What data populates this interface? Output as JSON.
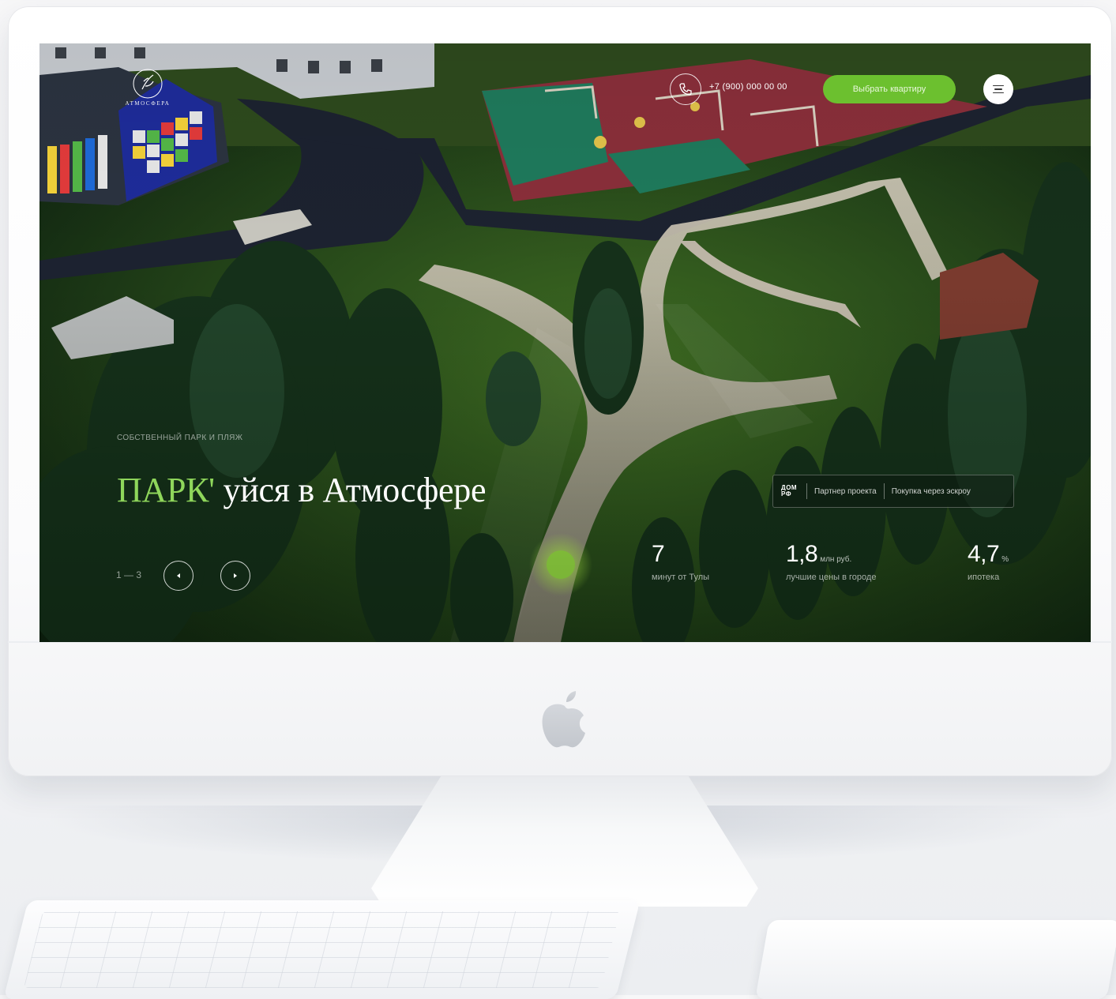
{
  "site": {
    "logo_text": "АТМОСФЕРА",
    "phone": "+7 (900) 000 00 00",
    "cta_label": "Выбрать квартиру"
  },
  "hero": {
    "eyebrow": "СОБСТВЕННЫЙ ПАРК И ПЛЯЖ",
    "headline_accent": "ПАРК'",
    "headline_rest": " уйся в Атмосфере",
    "counter": "1 — 3"
  },
  "partner": {
    "logo_line1": "ДОМ",
    "logo_line2": "РФ",
    "label": "Партнер проекта",
    "escrow": "Покупка через эскроу"
  },
  "stats": [
    {
      "value": "7",
      "unit": "",
      "caption": "минут от Тулы"
    },
    {
      "value": "1,8",
      "unit": "млн руб.",
      "caption": "лучшие цены в городе"
    },
    {
      "value": "4,7",
      "unit": "%",
      "caption": "ипотека"
    }
  ],
  "colors": {
    "accent_green": "#6cc02f",
    "headline_green": "#8fd65b"
  },
  "icons": {
    "phone": "phone-icon",
    "menu": "hamburger-icon",
    "prev": "arrow-left-icon",
    "next": "arrow-right-icon"
  }
}
